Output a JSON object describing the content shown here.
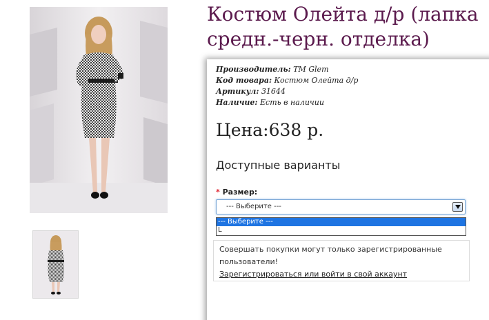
{
  "product": {
    "title": "Костюм Олейта д/р (лапка средн.-черн. отделка)",
    "main_image_alt": "Костюм Олейта д/р",
    "thumbnail_alt": "Костюм Олейта д/р, вид сзади"
  },
  "info": {
    "manufacturer_label": "Производитель:",
    "manufacturer_value": "TM Glem",
    "code_label": "Код товара:",
    "code_value": "Костюм Олейта д/р",
    "article_label": "Артикул:",
    "article_value": "31644",
    "availability_label": "Наличие:",
    "availability_value": "Есть в наличии"
  },
  "price": {
    "text": "Цена:638 р."
  },
  "options": {
    "heading": "Доступные варианты",
    "required_mark": "*",
    "size_label": "Размер:",
    "size_selected": "--- Выберите ---",
    "size_options": [
      "--- Выберите ---",
      "L"
    ]
  },
  "notice": {
    "text": "Совершать покупки могут только зарегистрированные пользователи!",
    "link": "Зарегистрироваться или войти в свой аккаунт"
  },
  "colors": {
    "title": "#5b1a4d",
    "required": "#e0232f",
    "option_highlight": "#1e74e2",
    "select_focus": "#7aa7d6"
  },
  "icons": {
    "select_arrow": "chevron-down-icon"
  }
}
